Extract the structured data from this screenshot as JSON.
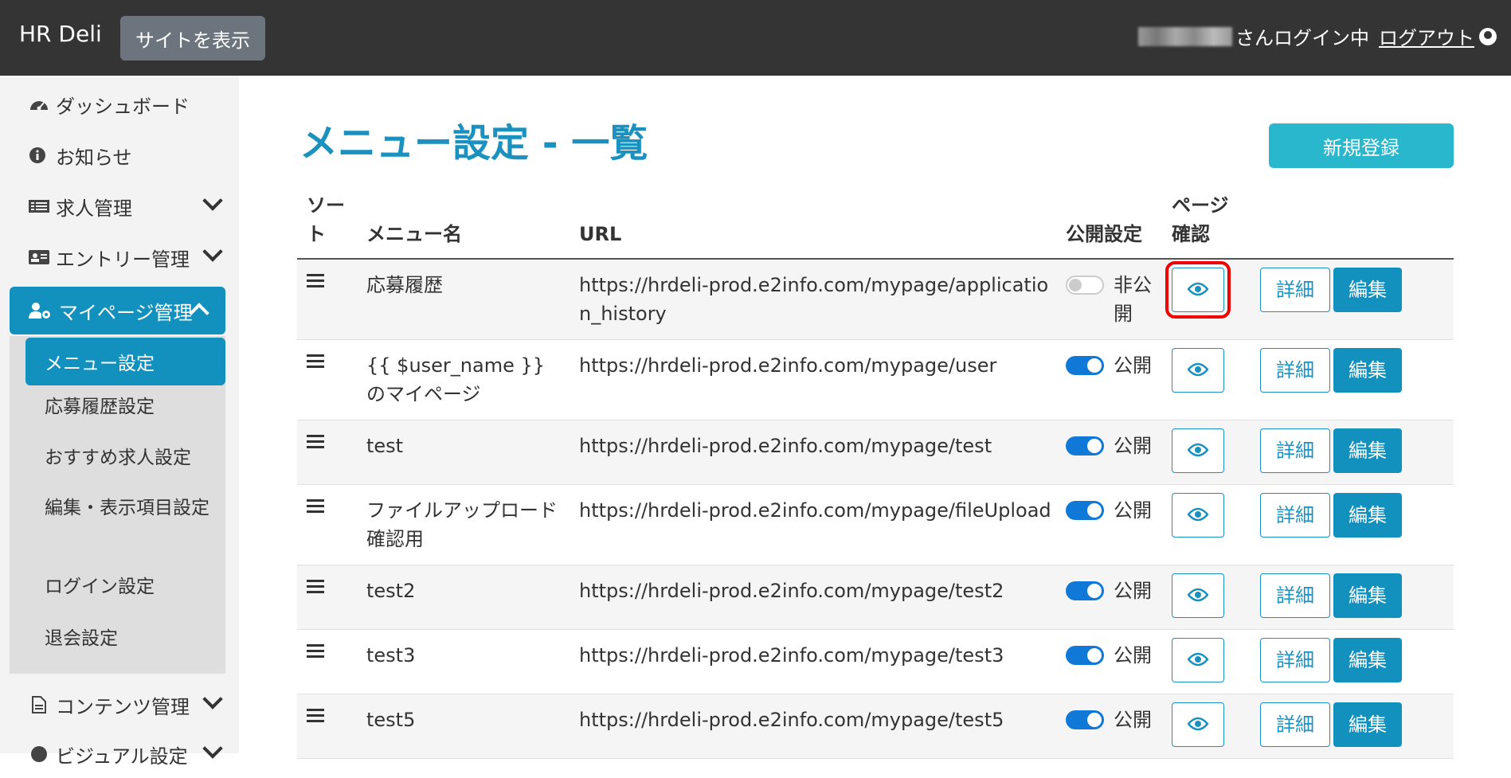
{
  "header": {
    "brand": "HR Deli",
    "site_button": "サイトを表示",
    "user_suffix": "さんログイン中",
    "logout": "ログアウト"
  },
  "sidebar": {
    "items": [
      {
        "label": "ダッシュボード",
        "icon": "dashboard-icon"
      },
      {
        "label": "お知らせ",
        "icon": "info-icon"
      },
      {
        "label": "求人管理",
        "icon": "list-icon"
      },
      {
        "label": "エントリー管理",
        "icon": "id-card-icon"
      },
      {
        "label": "マイページ管理",
        "icon": "user-cog-icon"
      },
      {
        "label": "コンテンツ管理",
        "icon": "file-icon"
      },
      {
        "label": "ビジュアル設定",
        "icon": "palette-icon"
      }
    ],
    "subitems": [
      "メニュー設定",
      "応募履歴設定",
      "おすすめ求人設定",
      "編集・表示項目設定",
      "ログイン設定",
      "退会設定"
    ]
  },
  "main": {
    "title": "メニュー設定 - 一覧",
    "new_button": "新規登録",
    "columns": {
      "sort": "ソート",
      "name": "メニュー名",
      "url": "URL",
      "public": "公開設定",
      "confirm": "ページ確認"
    },
    "detail_label": "詳細",
    "edit_label": "編集",
    "rows": [
      {
        "name": "応募履歴",
        "url": "https://hrdeli-prod.e2info.com/mypage/application_history",
        "status": "非公開",
        "on": false
      },
      {
        "name": "{{ $user_name }}のマイページ",
        "url": "https://hrdeli-prod.e2info.com/mypage/user",
        "status": "公開",
        "on": true
      },
      {
        "name": "test",
        "url": "https://hrdeli-prod.e2info.com/mypage/test",
        "status": "公開",
        "on": true
      },
      {
        "name": "ファイルアップロード確認用",
        "url": "https://hrdeli-prod.e2info.com/mypage/fileUpload",
        "status": "公開",
        "on": true
      },
      {
        "name": "test2",
        "url": "https://hrdeli-prod.e2info.com/mypage/test2",
        "status": "公開",
        "on": true
      },
      {
        "name": "test3",
        "url": "https://hrdeli-prod.e2info.com/mypage/test3",
        "status": "公開",
        "on": true
      },
      {
        "name": "test5",
        "url": "https://hrdeli-prod.e2info.com/mypage/test5",
        "status": "公開",
        "on": true
      }
    ]
  }
}
